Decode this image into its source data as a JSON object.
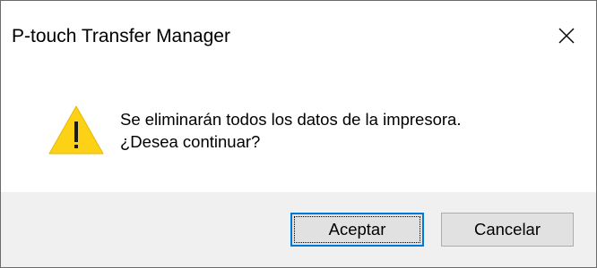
{
  "dialog": {
    "title": "P-touch Transfer Manager",
    "close_icon": "close-icon",
    "warning_icon": "warning-triangle-icon",
    "message_line1": "Se eliminarán todos los datos de la impresora.",
    "message_line2": "¿Desea continuar?",
    "ok_label": "Aceptar",
    "cancel_label": "Cancelar"
  },
  "colors": {
    "warning_fill": "#fcd116",
    "footer_background": "#f0f0f0",
    "default_button_border": "#0078d7"
  }
}
